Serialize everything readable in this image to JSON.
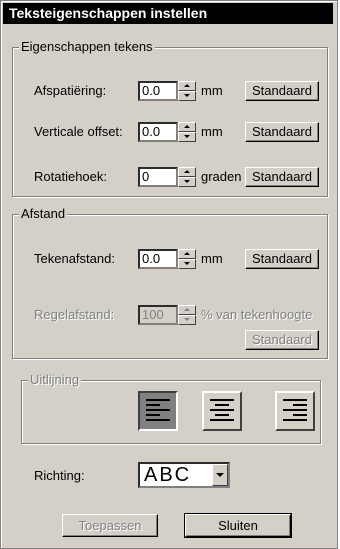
{
  "window": {
    "title": "Teksteigenschappen instellen"
  },
  "groups": {
    "eigenschappen": {
      "legend": "Eigenschappen tekens",
      "rows": [
        {
          "label": "Afspatiëring:",
          "value": "0.0",
          "unit": "mm",
          "button": "Standaard"
        },
        {
          "label": "Verticale offset:",
          "value": "0.0",
          "unit": "mm",
          "button": "Standaard"
        },
        {
          "label": "Rotatiehoek:",
          "value": "0",
          "unit": "graden",
          "button": "Standaard"
        }
      ]
    },
    "afstand": {
      "legend": "Afstand",
      "tekenafstand": {
        "label": "Tekenafstand:",
        "value": "0.0",
        "unit": "mm",
        "button": "Standaard"
      },
      "regelafstand": {
        "label": "Regelafstand:",
        "value": "100",
        "unit": "% van tekenhoogte",
        "button": "Standaard"
      }
    },
    "uitlijning": {
      "legend": "Uitlijning",
      "options": [
        {
          "icon": "align-left-icon",
          "selected": true
        },
        {
          "icon": "align-center-icon",
          "selected": false
        },
        {
          "icon": "align-right-icon",
          "selected": false
        }
      ]
    }
  },
  "richting": {
    "label": "Richting:",
    "value": "ABC"
  },
  "footer": {
    "apply": "Toepassen",
    "close": "Sluiten"
  }
}
